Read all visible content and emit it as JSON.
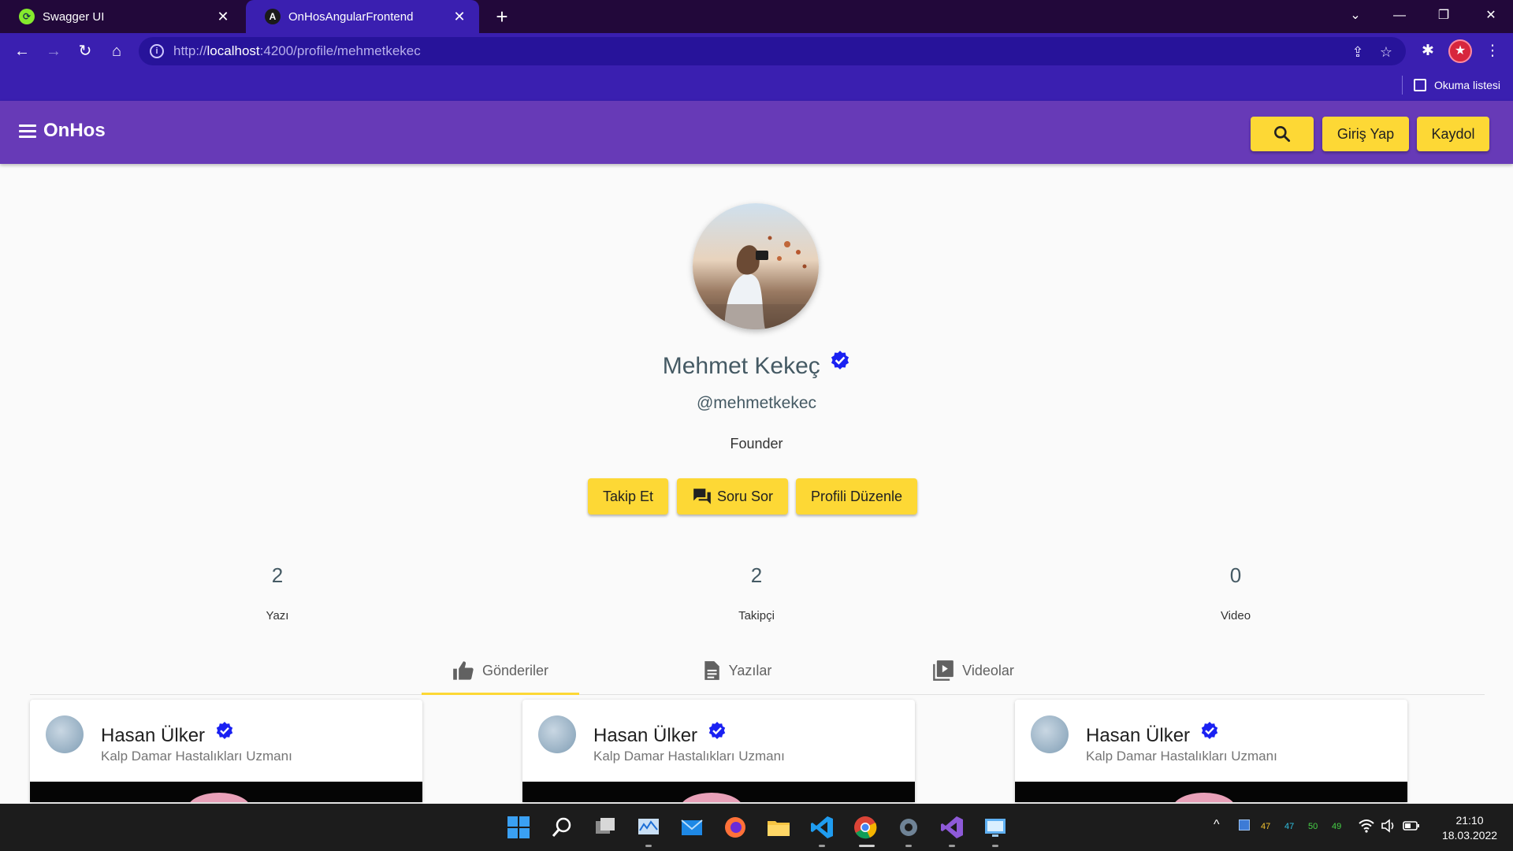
{
  "browser": {
    "tabs": [
      {
        "title": "Swagger UI"
      },
      {
        "title": "OnHosAngularFrontend"
      }
    ],
    "url_prefix": "http://",
    "url_host": "localhost",
    "url_rest": ":4200/profile/mehmetkekec",
    "reading_list": "Okuma listesi"
  },
  "app": {
    "brand": "OnHos",
    "login_label": "Giriş Yap",
    "signup_label": "Kaydol"
  },
  "profile": {
    "name": "Mehmet Kekeç",
    "username": "@mehmetkekec",
    "title": "Founder",
    "follow_label": "Takip Et",
    "ask_label": "Soru Sor",
    "edit_label": "Profili Düzenle",
    "stats": [
      {
        "value": "2",
        "label": "Yazı"
      },
      {
        "value": "2",
        "label": "Takipçi"
      },
      {
        "value": "0",
        "label": "Video"
      }
    ]
  },
  "tabs": [
    {
      "label": "Gönderiler",
      "icon": "thumb-up-icon",
      "selected": true
    },
    {
      "label": "Yazılar",
      "icon": "article-icon",
      "selected": false
    },
    {
      "label": "Videolar",
      "icon": "video-library-icon",
      "selected": false
    }
  ],
  "cards": [
    {
      "author": "Hasan Ülker",
      "subtitle": "Kalp Damar Hastalıkları Uzmanı"
    },
    {
      "author": "Hasan Ülker",
      "subtitle": "Kalp Damar Hastalıkları Uzmanı"
    },
    {
      "author": "Hasan Ülker",
      "subtitle": "Kalp Damar Hastalıkları Uzmanı"
    }
  ],
  "taskbar": {
    "tray_numbers": [
      "47",
      "47",
      "50",
      "49"
    ],
    "time": "21:10",
    "date": "18.03.2022"
  },
  "colors": {
    "primary": "#673ab7",
    "accent": "#fdd835",
    "verified": "#1a21f2",
    "browser_frame": "#3a1fb0"
  }
}
